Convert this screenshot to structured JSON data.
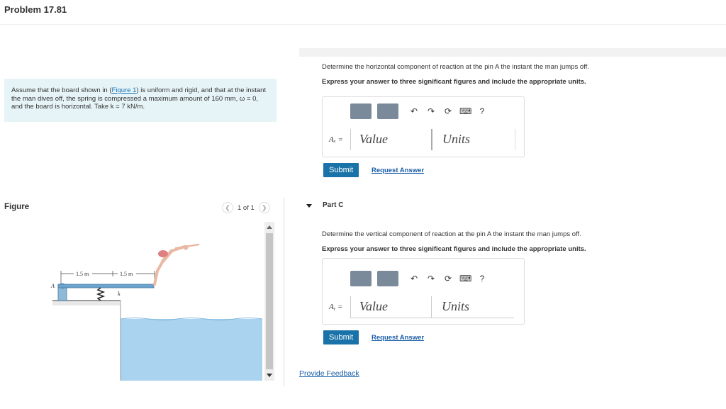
{
  "header": {
    "title": "Problem 17.81"
  },
  "problem": {
    "text_1": "Assume that the board shown in (",
    "figure_link": "Figure 1",
    "text_2": ") is uniform and rigid, and that at the instant the man dives off, the spring is compressed a maximum amount of 160 mm, ω = 0, and the board is horizontal. Take k = 7 kN/m."
  },
  "figure": {
    "label": "Figure",
    "pager": "1 of 1",
    "dim_left": "1.5 m",
    "dim_right": "1.5 m",
    "point_label": "A",
    "spring_label": "k"
  },
  "part_b": {
    "question": "Determine the horizontal component of reaction at the pin A the instant the man jumps off.",
    "instruction": "Express your answer to three significant figures and include the appropriate units.",
    "var_label": "Aₓ =",
    "value_placeholder": "Value",
    "units_placeholder": "Units",
    "submit": "Submit",
    "request": "Request Answer"
  },
  "part_c": {
    "title": "Part C",
    "question": "Determine the vertical component of reaction at the pin A the instant the man jumps off.",
    "instruction": "Express your answer to three significant figures and include the appropriate units.",
    "var_label": "Aᵧ =",
    "value_placeholder": "Value",
    "units_placeholder": "Units",
    "submit": "Submit",
    "request": "Request Answer"
  },
  "footer": {
    "feedback": "Provide Feedback"
  },
  "toolbar": {
    "help": "?"
  },
  "colors": {
    "accent": "#1a73a8",
    "problem_bg": "#e6f4f7",
    "water": "#a9d3ee"
  }
}
